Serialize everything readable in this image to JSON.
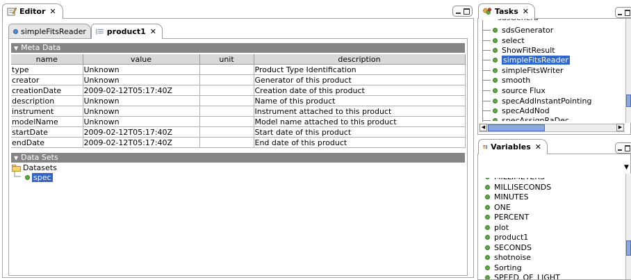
{
  "editor": {
    "tab_label": "Editor",
    "sub_tabs": [
      {
        "label": "simpleFitsReader",
        "active": false
      },
      {
        "label": "product1",
        "active": true
      }
    ],
    "meta_section_label": "Meta Data",
    "meta_columns": [
      "name",
      "value",
      "unit",
      "description"
    ],
    "meta_rows": [
      {
        "name": "type",
        "value": "Unknown",
        "unit": "",
        "description": "Product Type Identification"
      },
      {
        "name": "creator",
        "value": "Unknown",
        "unit": "",
        "description": "Generator of this product"
      },
      {
        "name": "creationDate",
        "value": "2009-02-12T05:17:40Z",
        "unit": "",
        "description": "Creation date of this product"
      },
      {
        "name": "description",
        "value": "Unknown",
        "unit": "",
        "description": "Name of this product"
      },
      {
        "name": "instrument",
        "value": "Unknown",
        "unit": "",
        "description": "Instrument attached to this product"
      },
      {
        "name": "modelName",
        "value": "Unknown",
        "unit": "",
        "description": "Model name attached to this product"
      },
      {
        "name": "startDate",
        "value": "2009-02-12T05:17:40Z",
        "unit": "",
        "description": "Start date of this product"
      },
      {
        "name": "endDate",
        "value": "2009-02-12T05:17:40Z",
        "unit": "",
        "description": "End date of this product"
      }
    ],
    "datasets_section_label": "Data Sets",
    "datasets_root": "Datasets",
    "datasets_child": "spec"
  },
  "tasks": {
    "tab_label": "Tasks",
    "items": [
      "sdsGenerator",
      "select",
      "ShowFitResult",
      "simpleFitsReader",
      "simpleFitsWriter",
      "smooth",
      "source Flux",
      "specAddInstantPointing",
      "specAddNod",
      "specAssignRaDec"
    ],
    "selected": "simpleFitsReader"
  },
  "variables": {
    "tab_label": "Variables",
    "items": [
      "MILLISECONDS",
      "MINUTES",
      "ONE",
      "PERCENT",
      "plot",
      "product1",
      "SECONDS",
      "shotnoise",
      "Sorting",
      "SPEED_OF_LIGHT"
    ]
  },
  "colors": {
    "selection": "#3366cc",
    "section_bar": "#858585",
    "status_dot": "#5fa844"
  }
}
